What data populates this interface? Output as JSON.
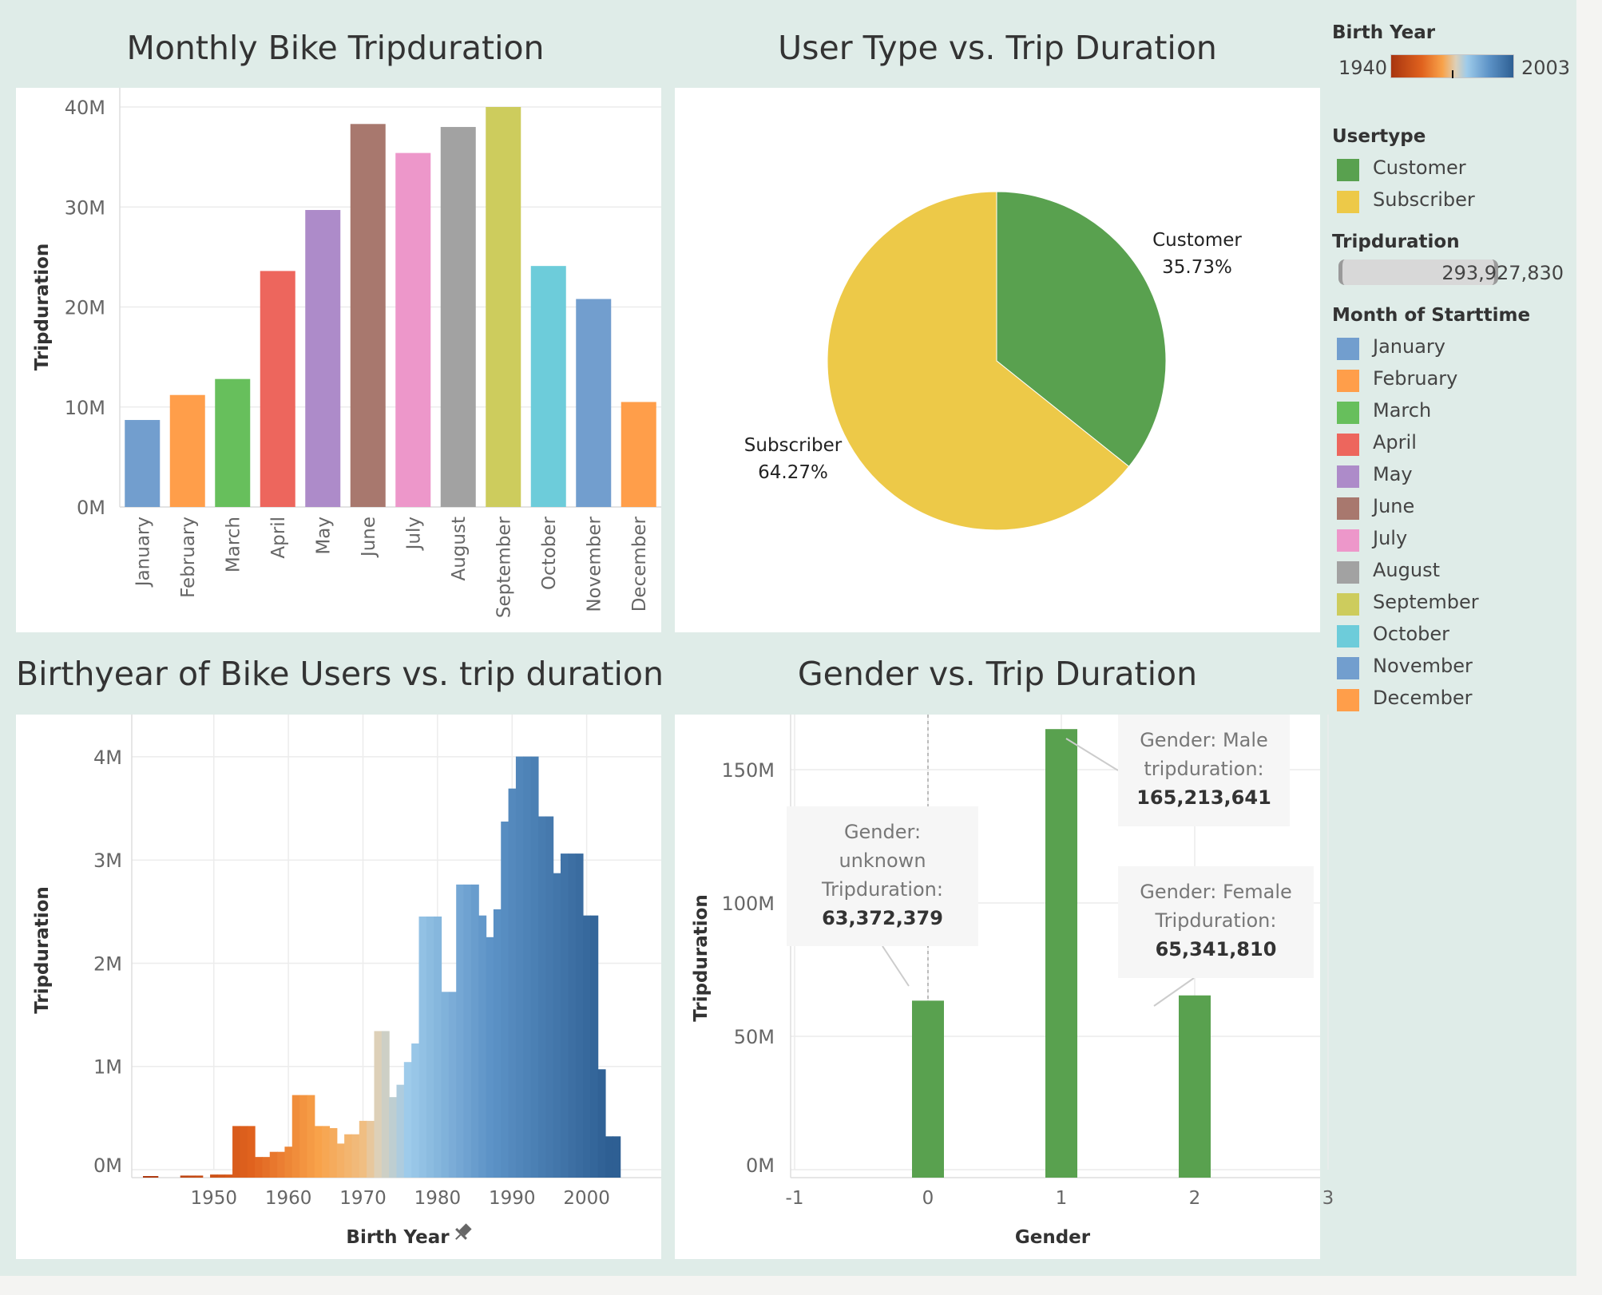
{
  "months": [
    "January",
    "February",
    "March",
    "April",
    "May",
    "June",
    "July",
    "August",
    "September",
    "October",
    "November",
    "December"
  ],
  "colors": {
    "months": [
      "#729ece",
      "#ff9e4a",
      "#67bf5c",
      "#ed665d",
      "#ad8bc9",
      "#a8786e",
      "#ed97ca",
      "#a2a2a2",
      "#cdcc5d",
      "#6dccda",
      "#729ece",
      "#ff9e4a"
    ],
    "customer": "#59a14f",
    "subscriber": "#edc948",
    "gender_bar": "#59a14f"
  },
  "legend": {
    "birth_year": {
      "title": "Birth Year",
      "min": "1940",
      "max": "2003"
    },
    "usertype": {
      "title": "Usertype",
      "items": [
        {
          "label": "Customer"
        },
        {
          "label": "Subscriber"
        }
      ]
    },
    "tripduration": {
      "title": "Tripduration",
      "value": "293,927,830"
    },
    "month": {
      "title": "Month of Starttime"
    }
  },
  "chart_data": [
    {
      "type": "bar",
      "title": "Monthly Bike Tripduration",
      "xlabel": "",
      "ylabel": "Tripduration",
      "categories": [
        "January",
        "February",
        "March",
        "April",
        "May",
        "June",
        "July",
        "August",
        "September",
        "October",
        "November",
        "December"
      ],
      "values": [
        8.7,
        11.2,
        12.8,
        23.6,
        29.7,
        38.3,
        35.4,
        38.0,
        40.0,
        24.1,
        20.8,
        10.5
      ],
      "value_unit": "M",
      "ylim": [
        0,
        40
      ],
      "yticks": [
        "0M",
        "10M",
        "20M",
        "30M",
        "40M"
      ],
      "grid": true,
      "legend": "right"
    },
    {
      "type": "pie",
      "title": "User Type vs. Trip Duration",
      "slices": [
        {
          "label": "Customer",
          "value": 35.73,
          "pct_label": "35.73%"
        },
        {
          "label": "Subscriber",
          "value": 64.27,
          "pct_label": "64.27%"
        }
      ],
      "legend": "right"
    },
    {
      "type": "bar",
      "title": "Birthyear of Bike Users vs. trip duration",
      "xlabel": "Birth Year",
      "ylabel": "Tripduration",
      "value_unit": "M",
      "x": [
        1941,
        1942,
        1943,
        1944,
        1945,
        1946,
        1947,
        1948,
        1949,
        1950,
        1951,
        1952,
        1953,
        1954,
        1955,
        1956,
        1957,
        1958,
        1959,
        1960,
        1961,
        1962,
        1963,
        1964,
        1965,
        1966,
        1967,
        1968,
        1969,
        1970,
        1971,
        1972,
        1973,
        1974,
        1975,
        1976,
        1977,
        1978,
        1979,
        1980,
        1981,
        1982,
        1983,
        1984,
        1985,
        1986,
        1987,
        1988,
        1989,
        1990,
        1991,
        1992,
        1993,
        1994,
        1995,
        1996,
        1997,
        1998,
        1999,
        2000,
        2001,
        2002,
        2003,
        2004
      ],
      "values": [
        0.01,
        0.01,
        0,
        0,
        0,
        0.02,
        0.02,
        0.02,
        0,
        0.03,
        0.03,
        0.03,
        0.5,
        0.5,
        0.5,
        0.2,
        0.2,
        0.25,
        0.25,
        0.3,
        0.8,
        0.8,
        0.8,
        0.5,
        0.5,
        0.48,
        0.33,
        0.42,
        0.42,
        0.55,
        0.55,
        1.42,
        1.42,
        0.78,
        0.9,
        1.12,
        1.3,
        2.53,
        2.53,
        2.53,
        1.8,
        1.8,
        2.84,
        2.84,
        2.84,
        2.54,
        2.33,
        2.6,
        3.45,
        3.77,
        4.08,
        4.08,
        4.08,
        3.5,
        3.5,
        2.95,
        3.14,
        3.14,
        3.14,
        2.54,
        2.54,
        1.05,
        0.4,
        0.4,
        0.2,
        0.1,
        0.1,
        0.05
      ],
      "xlim": [
        1939,
        2010
      ],
      "ylim": [
        0,
        4.1
      ],
      "xticks": [
        1950,
        1960,
        1970,
        1980,
        1990,
        2000
      ],
      "yticks": [
        "0M",
        "1M",
        "2M",
        "3M",
        "4M"
      ],
      "color_encoding": "Birth Year",
      "grid": true
    },
    {
      "type": "bar",
      "title": "Gender vs. Trip Duration",
      "xlabel": "Gender",
      "ylabel": "Tripduration",
      "x": [
        0,
        1,
        2
      ],
      "values": [
        63372379,
        165213641,
        65341810
      ],
      "xlim": [
        -1,
        3
      ],
      "xticks": [
        "-1",
        "0",
        "1",
        "2",
        "3"
      ],
      "ylim": [
        0,
        165213641
      ],
      "yticks": [
        "0M",
        "50M",
        "100M",
        "150M"
      ],
      "grid": true,
      "annotations": [
        {
          "lines": [
            "Gender:",
            "unknown",
            "Tripduration:"
          ],
          "value": "63,372,379"
        },
        {
          "lines": [
            "Gender: Male",
            "tripduration:"
          ],
          "value": "165,213,641"
        },
        {
          "lines": [
            "Gender: Female",
            "Tripduration:"
          ],
          "value": "65,341,810"
        }
      ]
    }
  ]
}
